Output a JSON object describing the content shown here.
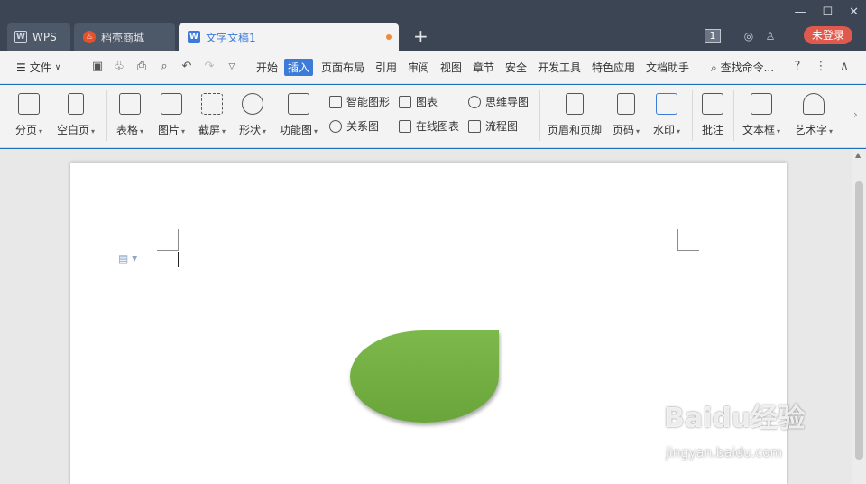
{
  "tabs": [
    {
      "label": "WPS",
      "icon": "wps-logo-icon"
    },
    {
      "label": "稻壳商城",
      "icon": "docer-store-icon"
    },
    {
      "label": "文字文稿1",
      "icon": "writer-doc-icon",
      "active": true
    }
  ],
  "titlebar": {
    "badge": "1",
    "login_label": "未登录"
  },
  "menubar": {
    "file_label": "文件",
    "items": [
      "开始",
      "插入",
      "页面布局",
      "引用",
      "审阅",
      "视图",
      "章节",
      "安全",
      "开发工具",
      "特色应用",
      "文档助手"
    ],
    "active": "插入",
    "search_label": "查找命令..."
  },
  "ribbon": {
    "page_break": "分页",
    "blank_page": "空白页",
    "table": "表格",
    "picture": "图片",
    "screenshot": "截屏",
    "shape": "形状",
    "function_chart": "功能图",
    "smart_art": "智能图形",
    "relation": "关系图",
    "chart": "图表",
    "online_chart": "在线图表",
    "mind_map": "思维导图",
    "flowchart": "流程图",
    "header_footer": "页眉和页脚",
    "page_number": "页码",
    "watermark": "水印",
    "comment": "批注",
    "text_box": "文本框",
    "word_art": "艺术字"
  },
  "colors": {
    "accent": "#3d7bd8",
    "leaf": "#6aa53b",
    "login": "#e0594d"
  },
  "watermark": {
    "brand": "Baidu经验",
    "url": "jingyan.baidu.com"
  }
}
